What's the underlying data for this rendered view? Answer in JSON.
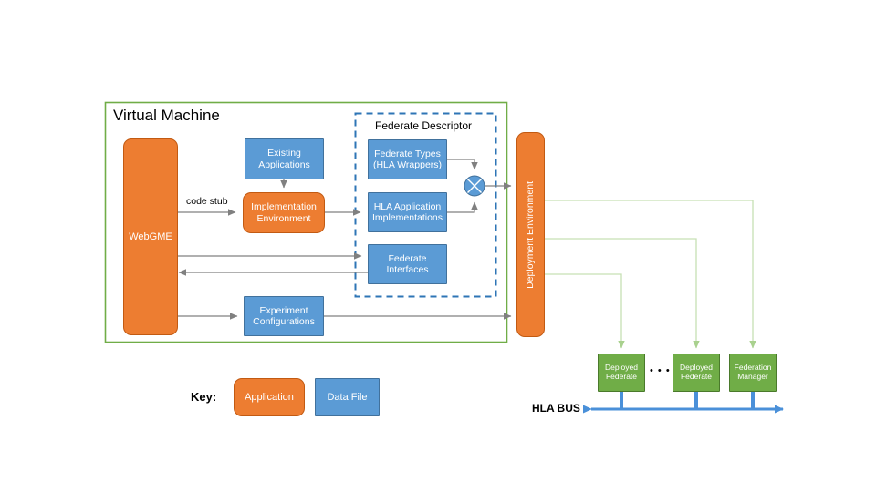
{
  "diagram": {
    "title_vm": "Virtual Machine",
    "title_fd": "Federate Descriptor",
    "colors": {
      "application": "#ED7D31",
      "data_file": "#5B9BD5",
      "deployed": "#70AD47",
      "vm_border": "#70AD47",
      "fd_border": "#2E75B6",
      "bus": "#4A90D9",
      "edge": "#808080",
      "green_edge": "#C6E0B4"
    }
  },
  "nodes": {
    "webgme": "WebGME",
    "existing_applications": "Existing\nApplications",
    "existing_applications_l1": "Existing",
    "existing_applications_l2": "Applications",
    "implementation_environment_l1": "Implementation",
    "implementation_environment_l2": "Environment",
    "federate_types_l1": "Federate Types",
    "federate_types_l2": "(HLA Wrappers)",
    "hla_app_impl_l1": "HLA Application",
    "hla_app_impl_l2": "Implementations",
    "federate_interfaces_l1": "Federate",
    "federate_interfaces_l2": "Interfaces",
    "experiment_configurations_l1": "Experiment",
    "experiment_configurations_l2": "Configurations",
    "deployment_environment": "Deployment Environment",
    "deployed_federate_1_l1": "Deployed",
    "deployed_federate_1_l2": "Federate",
    "deployed_federate_2_l1": "Deployed",
    "deployed_federate_2_l2": "Federate",
    "federation_manager_l1": "Federation",
    "federation_manager_l2": "Manager",
    "ellipsis": "• • •"
  },
  "edges": {
    "code_stub": "code stub"
  },
  "bus": {
    "label": "HLA BUS"
  },
  "key": {
    "label": "Key:",
    "application": "Application",
    "data_file": "Data File"
  }
}
